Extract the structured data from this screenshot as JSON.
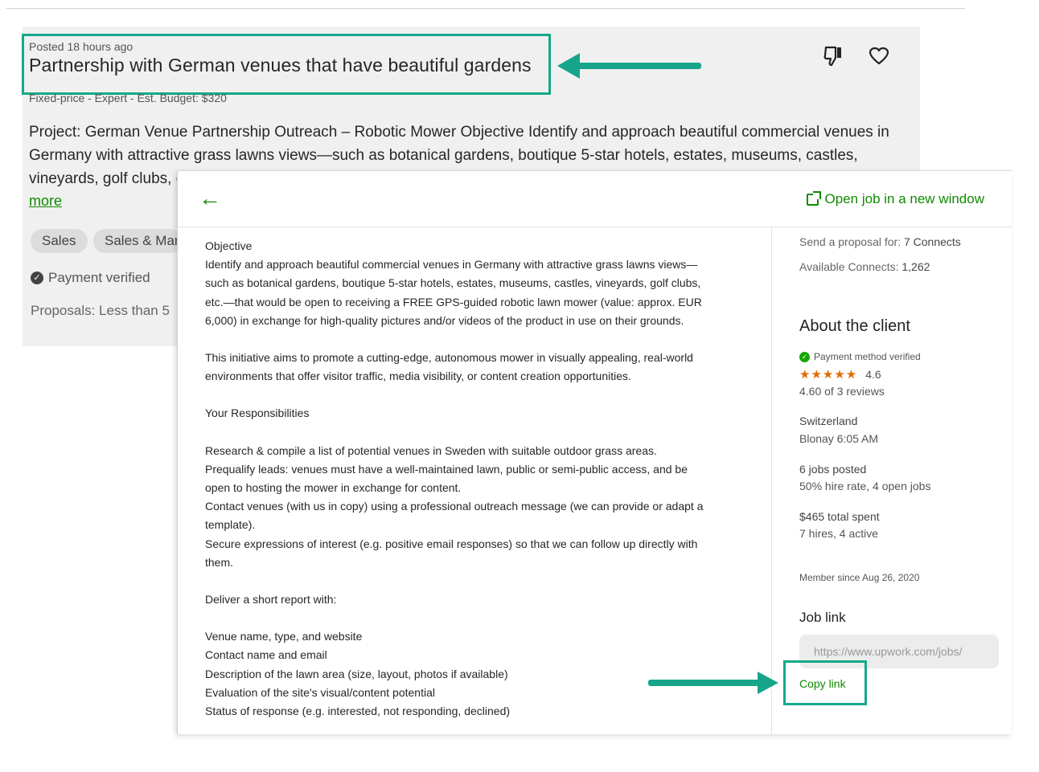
{
  "listing": {
    "posted": "Posted 18 hours ago",
    "title": "Partnership with German venues that have beautiful gardens",
    "meta": "Fixed-price - Expert - Est. Budget: $320",
    "description": "Project: German Venue Partnership Outreach – Robotic Mower Objective Identify and approach beautiful commercial venues in Germany with attractive grass lawns views—such as botanical gardens, boutique 5-star hotels, estates, museums, castles, vineyards, golf clubs, e",
    "more": "more",
    "tags": [
      "Sales",
      "Sales & Mar"
    ],
    "payment_verified": "Payment verified",
    "proposals": "Proposals: Less than 5",
    "dislike_icon": "thumbs-down-icon",
    "save_icon": "heart-icon"
  },
  "detail": {
    "back_icon": "arrow-left-icon",
    "open_new_window": "Open job in a new window",
    "body": [
      "Objective",
      "Identify and approach beautiful commercial venues in Germany with attractive grass lawns views—",
      "such as botanical gardens, boutique 5-star hotels, estates, museums, castles, vineyards, golf clubs,",
      "etc.—that would be open to receiving a FREE GPS-guided robotic lawn mower (value: approx. EUR",
      "6,000) in exchange for high-quality pictures and/or videos of the product in use on their grounds.",
      "",
      "This initiative aims to promote a cutting-edge, autonomous mower in visually appealing, real-world",
      "environments that offer visitor traffic, media visibility, or content creation opportunities.",
      "",
      "Your Responsibilities",
      "",
      "Research & compile a list of potential venues in Sweden with suitable outdoor grass areas.",
      "Prequalify leads: venues must have a well-maintained lawn, public or semi-public access, and be",
      "open to hosting the mower in exchange for content.",
      "Contact venues (with us in copy) using a professional outreach message (we can provide or adapt a",
      "template).",
      "Secure expressions of interest (e.g. positive email responses) so that we can follow up directly with",
      "them.",
      "",
      "Deliver a short report with:",
      "",
      "Venue name, type, and website",
      "Contact name and email",
      "Description of the lawn area (size, layout, photos if available)",
      "Evaluation of the site's visual/content potential",
      "Status of response (e.g. interested, not responding, declined)"
    ]
  },
  "sidebar": {
    "proposal_label": "Send a proposal for: ",
    "proposal_value": "7 Connects",
    "available_label": "Available Connects: ",
    "available_value": "1,262",
    "about_title": "About the client",
    "payment_method": "Payment method verified",
    "stars": "★★★★★",
    "rating": "4.6",
    "reviews": "4.60 of 3 reviews",
    "country": "Switzerland",
    "city_time": "Blonay 6:05 AM",
    "jobs_posted": "6 jobs posted",
    "hire_rate": "50% hire rate, 4 open jobs",
    "total_spent": "$465 total spent",
    "hires": "7 hires, 4 active",
    "member_since": "Member since Aug 26, 2020",
    "job_link_title": "Job link",
    "job_link_url": "https://www.upwork.com/jobs/",
    "copy_link": "Copy link"
  },
  "colors": {
    "accent_green": "#108a00",
    "highlight_teal": "#14a889",
    "star_orange": "#e06c00"
  }
}
